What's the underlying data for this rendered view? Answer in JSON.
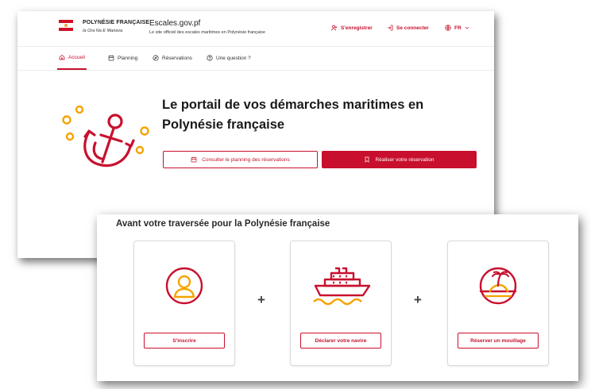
{
  "header": {
    "gov_name": "POLYNÉSIE FRANÇAISE",
    "gov_motto": "Ia Ora Na E Manava",
    "site_name": "Escales.gov.pf",
    "site_subtitle": "Le site officiel des escales maritimes en Polynésie française",
    "register_label": "S'enregistrer",
    "login_label": "Se connecter",
    "language": "FR"
  },
  "nav": {
    "tabs": [
      {
        "label": "Accueil",
        "icon": "home-icon",
        "active": true
      },
      {
        "label": "Planning",
        "icon": "calendar-icon"
      },
      {
        "label": "Réservations",
        "icon": "compass-icon"
      },
      {
        "label": "Une question ?",
        "icon": "help-icon"
      }
    ]
  },
  "hero": {
    "title_line1": "Le portail de vos démarches maritimes en",
    "title_line2": "Polynésie française",
    "planning_button": "Consulter le planning des réservations",
    "reserve_button": "Réaliser votre réservation"
  },
  "steps_section": {
    "title": "Avant votre traversée pour la Polynésie française",
    "steps": [
      {
        "label": "S'inscrire",
        "icon": "user-icon"
      },
      {
        "label": "Déclarer votre navire",
        "icon": "ship-icon"
      },
      {
        "label": "Réserver un mouillage",
        "icon": "island-icon"
      }
    ],
    "separator": "+"
  },
  "colors": {
    "accent": "#c8102e",
    "icon_secondary": "#f4a300"
  }
}
